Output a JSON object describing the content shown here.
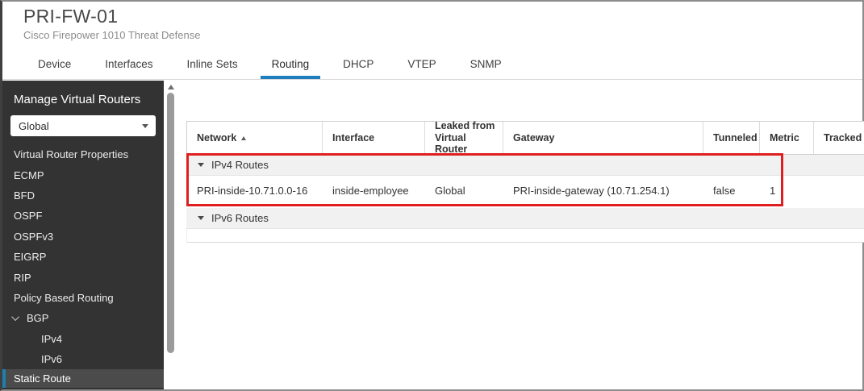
{
  "header": {
    "device_name": "PRI-FW-01",
    "device_model": "Cisco Firepower 1010 Threat Defense",
    "tabs": [
      {
        "label": "Device",
        "active": false
      },
      {
        "label": "Interfaces",
        "active": false
      },
      {
        "label": "Inline Sets",
        "active": false
      },
      {
        "label": "Routing",
        "active": true
      },
      {
        "label": "DHCP",
        "active": false
      },
      {
        "label": "VTEP",
        "active": false
      },
      {
        "label": "SNMP",
        "active": false
      }
    ]
  },
  "sidebar": {
    "heading": "Manage Virtual Routers",
    "router_select": {
      "value": "Global"
    },
    "items": [
      "Virtual Router Properties",
      "ECMP",
      "BFD",
      "OSPF",
      "OSPFv3",
      "EIGRP",
      "RIP",
      "Policy Based Routing"
    ],
    "bgp": {
      "label": "BGP",
      "expanded": true,
      "children": [
        "IPv4",
        "IPv6"
      ]
    },
    "selected_item": "Static Route"
  },
  "routes_table": {
    "columns": [
      "Network",
      "Interface",
      "Leaked from Virtual Router",
      "Gateway",
      "Tunneled",
      "Metric",
      "Tracked"
    ],
    "sort": {
      "column": "Network",
      "direction": "asc"
    },
    "groups": [
      {
        "label": "IPv4 Routes",
        "expanded": true,
        "rows": [
          {
            "network": "PRI-inside-10.71.0.0-16",
            "interface": "inside-employee",
            "leaked_from_virtual_router": "Global",
            "gateway": "PRI-inside-gateway (10.71.254.1)",
            "tunneled": "false",
            "metric": "1",
            "tracked": ""
          }
        ]
      },
      {
        "label": "IPv6 Routes",
        "expanded": true,
        "rows": []
      }
    ]
  },
  "annotation": {
    "type": "highlight-box",
    "target": "IPv4 Routes section",
    "color": "#df1f1f"
  },
  "colors": {
    "tab_accent": "#1f7ebe",
    "sidebar_bg": "#333333",
    "sidebar_selected_bg": "#4b4b4b",
    "sidebar_accent": "#1f7fae",
    "group_row_bg": "#f1f1f2",
    "annotation_red": "#df1f1f"
  }
}
